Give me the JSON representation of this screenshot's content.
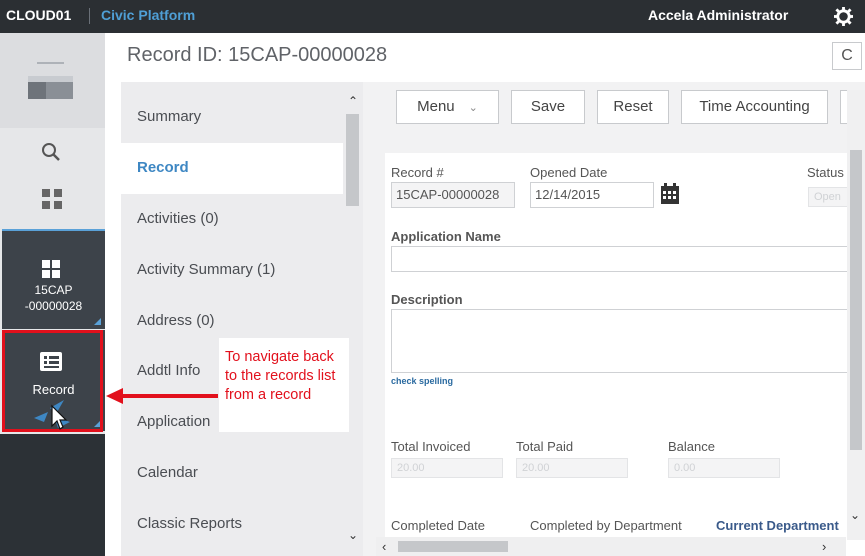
{
  "topbar": {
    "env": "CLOUD01",
    "app": "Civic Platform",
    "user": "Accela Administrator",
    "gear_icon": "gear-icon"
  },
  "rail": {
    "menu_icon": "hamburger-menu-icon",
    "search_icon": "search-icon",
    "apps_icon": "grid-apps-icon",
    "tab_record_line1": "15CAP",
    "tab_record_line2": "-00000028",
    "record_list_label": "Record"
  },
  "header": {
    "title": "Record ID: 15CAP-00000028",
    "refresh_label": "C"
  },
  "sections": [
    {
      "label": "Summary",
      "active": false
    },
    {
      "label": "Record",
      "active": true
    },
    {
      "label": "Activities (0)",
      "active": false
    },
    {
      "label": "Activity Summary (1)",
      "active": false
    },
    {
      "label": "Address (0)",
      "active": false
    },
    {
      "label": "Addtl Info",
      "active": false
    },
    {
      "label": "Application",
      "active": false
    },
    {
      "label": "Calendar",
      "active": false
    },
    {
      "label": "Classic Reports",
      "active": false
    }
  ],
  "annotation": {
    "text": "To navigate back to the records list from a record",
    "color": "#e2101c"
  },
  "toolbar": {
    "menu": "Menu",
    "save": "Save",
    "reset": "Reset",
    "time_accounting": "Time Accounting"
  },
  "form": {
    "record_no_label": "Record #",
    "record_no_value": "15CAP-00000028",
    "opened_date_label": "Opened Date",
    "opened_date_value": "12/14/2015",
    "status_label": "Status",
    "status_value": "Open",
    "application_name_label": "Application Name",
    "description_label": "Description",
    "check_spelling": "check spelling",
    "total_invoiced_label": "Total Invoiced",
    "total_invoiced_value": "20.00",
    "total_paid_label": "Total Paid",
    "total_paid_value": "20.00",
    "balance_label": "Balance",
    "balance_value": "0.00",
    "completed_date_label": "Completed Date",
    "completed_by_dept_label": "Completed by Department",
    "current_dept_label": "Current Department"
  },
  "colors": {
    "accent": "#3e87c3",
    "topbar": "#2b2f33",
    "rail_dark": "#3d434a",
    "highlight_red": "#e2101c"
  }
}
